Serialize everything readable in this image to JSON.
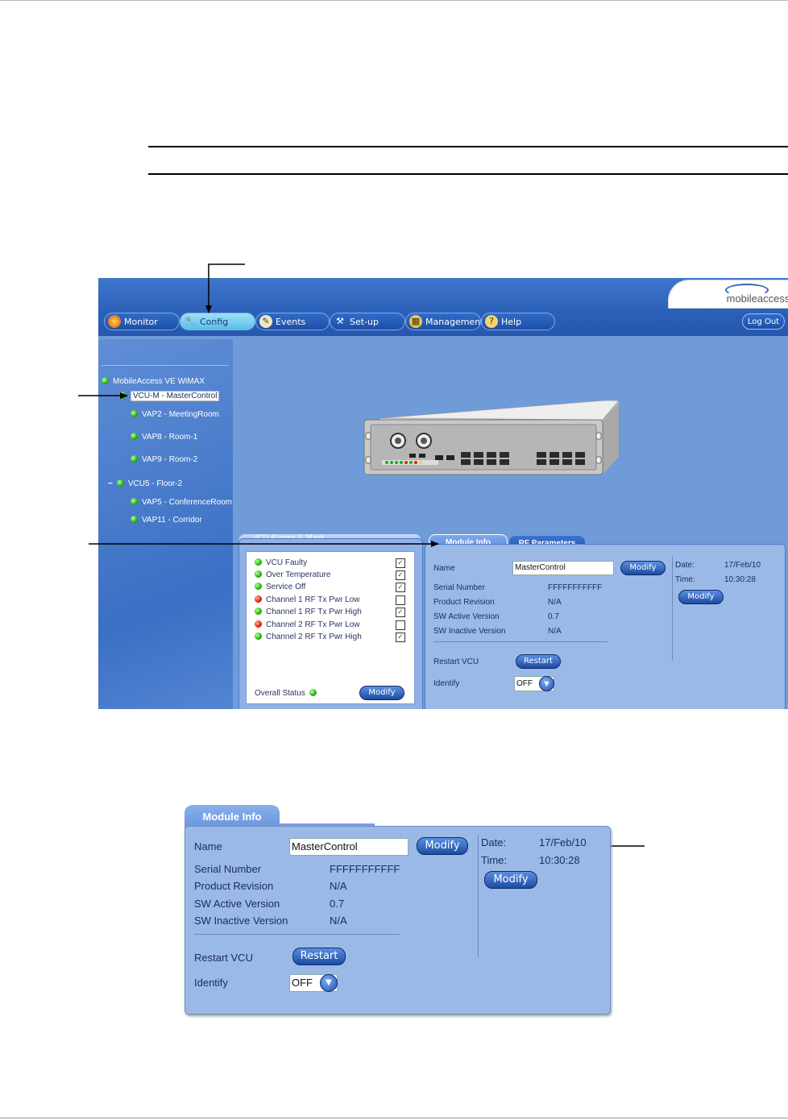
{
  "tabs": [
    {
      "label": "Monitor",
      "icon": "monitor-icon"
    },
    {
      "label": "Config",
      "icon": "wrench-icon"
    },
    {
      "label": "Events",
      "icon": "events-icon"
    },
    {
      "label": "Set-up",
      "icon": "tools-icon"
    },
    {
      "label": "Management",
      "icon": "management-icon"
    },
    {
      "label": "Help",
      "icon": "help-icon"
    }
  ],
  "logout_label": "Log Out",
  "logo_text": "mobileaccess.",
  "tree": {
    "root": "MobileAccess VE WiMAX",
    "nodes": [
      "VCU-M - MasterControl",
      "VAP2 - MeetingRoom",
      "VAP8 - Room-1",
      "VAP9 - Room-2",
      "VCU5 - Floor-2",
      "VAP5 - ConferenceRoom",
      "VAP11 - Corridor"
    ],
    "collapse_symbol": "−"
  },
  "alarms": {
    "tab_label": "VCU Alarms & Mask",
    "items": [
      {
        "label": "VCU Faulty",
        "status": "green",
        "masked": true
      },
      {
        "label": "Over Temperature",
        "status": "green",
        "masked": true
      },
      {
        "label": "Service Off",
        "status": "green",
        "masked": true
      },
      {
        "label": "Channel 1 RF Tx Pwr Low",
        "status": "red",
        "masked": false
      },
      {
        "label": "Channel 1 RF Tx Pwr High",
        "status": "green",
        "masked": true
      },
      {
        "label": "Channel 2 RF Tx Pwr Low",
        "status": "red",
        "masked": false
      },
      {
        "label": "Channel 2 RF Tx Pwr High",
        "status": "green",
        "masked": true
      }
    ],
    "overall_status_label": "Overall Status",
    "modify_label": "Modify"
  },
  "module_tabs": [
    "Module Info",
    "RF Parameters"
  ],
  "module_info": {
    "name_label": "Name",
    "name_value": "MasterControl",
    "modify_label": "Modify",
    "serial_label": "Serial Number",
    "serial_value": "FFFFFFFFFFF",
    "product_revision_label": "Product Revision",
    "product_revision_value": "N/A",
    "sw_active_label": "SW Active Version",
    "sw_active_value": "0.7",
    "sw_inactive_label": "SW Inactive Version",
    "sw_inactive_value": "N/A",
    "restart_label": "Restart VCU",
    "restart_button": "Restart",
    "identify_label": "Identify",
    "identify_value": "OFF",
    "date_label": "Date:",
    "date_value": "17/Feb/10",
    "time_label": "Time:",
    "time_value": "10:30:28",
    "datetime_modify_label": "Modify"
  },
  "colors": {
    "toolbar": "#2b60b8",
    "panel": "#9bb9e6",
    "button": "#1c4ba2",
    "status_green": "#25b20d",
    "status_red": "#e21b0a"
  }
}
